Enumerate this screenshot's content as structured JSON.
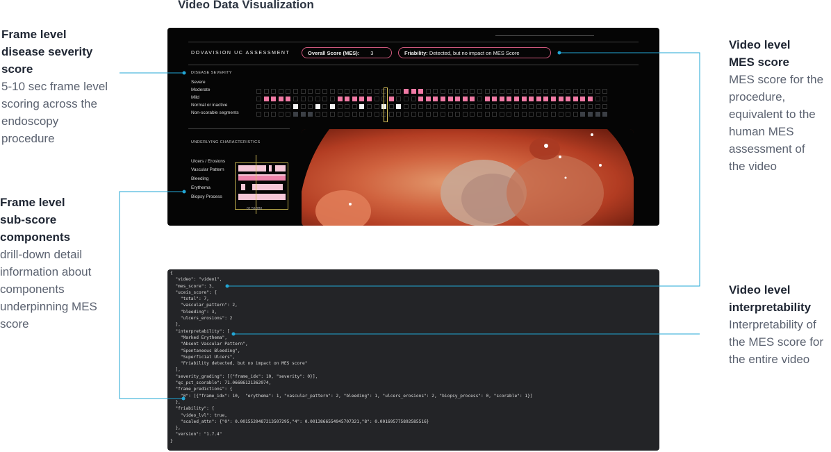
{
  "header": {
    "title": "Video Data Visualization"
  },
  "annotations": {
    "frame_severity": {
      "heading": [
        "Frame level",
        "disease severity",
        "score"
      ],
      "body": [
        "5-10 sec frame level",
        "scoring across the",
        "endoscopy",
        "procedure"
      ]
    },
    "subscore": {
      "heading": [
        "Frame level",
        "sub-score",
        "components"
      ],
      "body": [
        "drill-down detail",
        "information about",
        "components",
        "underpinning MES",
        "score"
      ]
    },
    "video_mes": {
      "heading": [
        "Video level",
        "MES score"
      ],
      "body": [
        "MES score for the",
        "procedure,",
        "equivalent to the",
        "human MES",
        "assessment of",
        "the video"
      ]
    },
    "video_interp": {
      "heading": [
        "Video level",
        "interpretability"
      ],
      "body": [
        "Interpretability of",
        "the MES score for",
        "the entire video"
      ]
    }
  },
  "dashboard": {
    "brand": "DOVAVISION UC ASSESSMENT",
    "overall_label": "Overall Score (MES):",
    "overall_value": "3",
    "friability_label": "Friability:",
    "friability_value": "Detected, but no impact on MES Score",
    "severity_title": "DISEASE SEVERITY",
    "severity_levels": [
      "Severe",
      "Moderate",
      "Mild",
      "Normal or inactive",
      "Non-scorable segments"
    ],
    "underlying_title": "UNDERLYING CHARACTERISTICS",
    "subscores": [
      "Ulcers / Erosions",
      "Vascular Pattern",
      "Bleeding",
      "Erythema",
      "Biopsy Process"
    ],
    "timestamp": "01:59.280"
  },
  "colors": {
    "accent": "#22a7d6",
    "pink": "#f07aa5",
    "pill_border": "#d05a7e"
  },
  "json_lines": [
    "{",
    "  \"video\": \"video1\",",
    "  \"mes_score\": 3,",
    "  \"uceis_score\": {",
    "    \"total\": 7,",
    "    \"vascular_pattern\": 2,",
    "    \"bleeding\": 3,",
    "    \"ulcers_erosions\": 2",
    "  },",
    "  \"interpretability\": [",
    "    \"Marked Erythema\",",
    "    \"Absent Vascular Pattern\",",
    "    \"Spontaneous Bleeding\",",
    "    \"Superficial Ulcers\",",
    "    \"Friability detected, but no impact on MES score\"",
    "  ],",
    "  \"severity_grading\": [{\"frame_idx\": 10, \"severity\": 0}],",
    "  \"qc_pct_scorable\": 71.06686121362974,",
    "  \"frame_predictions\": {",
    "    \"0\": [{\"frame_idx\": 10,  \"erythema\": 1, \"vascular_pattern\": 2, \"bleeding\": 1, \"ulcers_erosions\": 2, \"biopsy_process\": 0, \"scorable\": 1}]",
    "  },",
    "  \"friability\": {",
    "    \"video_lvl\": true,",
    "    \"scaled_attn\": {\"0\": 0.0015520487213507295,\"4\": 0.0013866554945707321,\"8\": 0.001695775892585516}",
    "  },",
    "  \"version\": \"1.7.4\"",
    "}"
  ]
}
